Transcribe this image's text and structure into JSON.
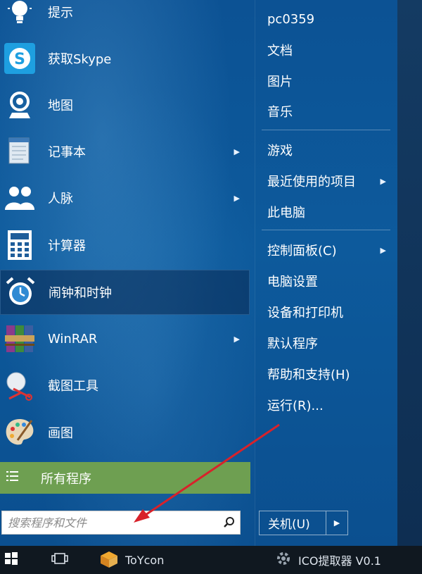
{
  "programs": [
    {
      "label": "提示",
      "icon": "lightbulb-icon",
      "has_arrow": false,
      "selected": false
    },
    {
      "label": "获取Skype",
      "icon": "skype-icon",
      "has_arrow": false,
      "selected": false
    },
    {
      "label": "地图",
      "icon": "map-pin-icon",
      "has_arrow": false,
      "selected": false
    },
    {
      "label": "记事本",
      "icon": "notepad-icon",
      "has_arrow": true,
      "selected": false
    },
    {
      "label": "人脉",
      "icon": "people-icon",
      "has_arrow": true,
      "selected": false
    },
    {
      "label": "计算器",
      "icon": "calculator-icon",
      "has_arrow": false,
      "selected": false
    },
    {
      "label": "闹钟和时钟",
      "icon": "alarm-clock-icon",
      "has_arrow": false,
      "selected": true
    },
    {
      "label": "WinRAR",
      "icon": "winrar-icon",
      "has_arrow": true,
      "selected": false
    },
    {
      "label": "截图工具",
      "icon": "snipping-tool-icon",
      "has_arrow": false,
      "selected": false
    },
    {
      "label": "画图",
      "icon": "paint-palette-icon",
      "has_arrow": false,
      "selected": false
    }
  ],
  "all_programs": {
    "label": "所有程序",
    "icon": "list-icon"
  },
  "search": {
    "placeholder": "搜索程序和文件",
    "icon": "search-icon"
  },
  "right_menu": {
    "group1": [
      {
        "label": "pc0359"
      },
      {
        "label": "文档"
      },
      {
        "label": "图片"
      },
      {
        "label": "音乐"
      }
    ],
    "group2": [
      {
        "label": "游戏",
        "has_arrow": false
      },
      {
        "label": "最近使用的项目",
        "has_arrow": true
      },
      {
        "label": "此电脑",
        "has_arrow": false
      }
    ],
    "group3": [
      {
        "label": "控制面板(C)",
        "has_arrow": true
      },
      {
        "label": "电脑设置",
        "has_arrow": false
      },
      {
        "label": "设备和打印机",
        "has_arrow": false
      },
      {
        "label": "默认程序",
        "has_arrow": false
      },
      {
        "label": "帮助和支持(H)",
        "has_arrow": false
      },
      {
        "label": "运行(R)...",
        "has_arrow": false
      }
    ]
  },
  "power": {
    "label": "关机(U)",
    "arrow": "▶"
  },
  "arrow_glyph": "▶",
  "taskbar": {
    "items": [
      {
        "label": "",
        "icon": "windows-logo-icon"
      },
      {
        "label": "",
        "icon": "task-view-icon"
      },
      {
        "label": "ToYcon",
        "icon": "toycon-app-icon"
      },
      {
        "label": "ICO提取器 V0.1",
        "icon": "ico-extractor-app-icon"
      }
    ]
  },
  "colors": {
    "accent": "#0c5294",
    "all_programs_bg": "#6e9f51",
    "annotation": "#d8222a"
  }
}
